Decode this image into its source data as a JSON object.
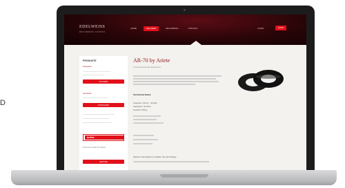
{
  "stray_char": "D",
  "site": {
    "logo_text": "EDELWEISS",
    "logo_subtitle": "RECORDING STUDIO",
    "nav": [
      "HOME",
      "ANLAGEN",
      "RECORDING",
      "KONTAKT"
    ],
    "header_link": "LOGIN",
    "header_cta": "SHOP"
  },
  "sidebar": {
    "heading": "PRODUKTE",
    "links": [
      "Kategorie",
      "Hersteller"
    ],
    "buttons": [
      "SUCHEN",
      "ANFRAGEN",
      "WEITER"
    ],
    "brand_logo": "arlete",
    "caption": "Premium Audio Products"
  },
  "main": {
    "title": "AR-70 by Ariete",
    "subtitle": "Professional Audio Equipment",
    "spec_heading": "Technische Daten",
    "spec_lines": [
      "Frequenz: 20 Hz – 20 kHz",
      "Impedanz: 32 Ohm",
      "Gewicht: 250 g"
    ],
    "footer_text": "Weitere Informationen erhalten Sie auf Anfrage."
  },
  "colors": {
    "accent": "#e2101a",
    "header_dark": "#2a0508",
    "title": "#8b1318"
  },
  "icons": {
    "product": "black-headphones-ring-image"
  }
}
